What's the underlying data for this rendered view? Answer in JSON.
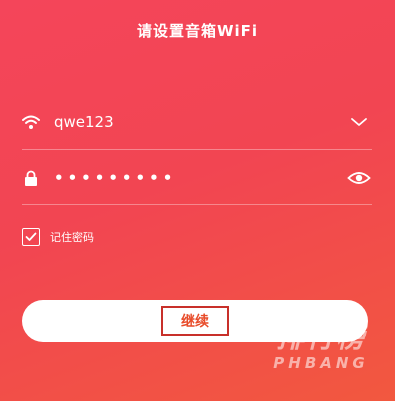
{
  "header": {
    "title": "请设置音箱WiFi"
  },
  "wifi": {
    "icon": "wifi-icon",
    "ssid": "qwe123",
    "dropdown_icon": "chevron-down-icon"
  },
  "password": {
    "icon": "lock-icon",
    "masked_value": "•••••••••",
    "visibility_icon": "eye-icon"
  },
  "remember": {
    "checked": true,
    "label": "记住密码"
  },
  "actions": {
    "continue_label": "继续"
  },
  "watermark": {
    "top": "排行榜",
    "bottom": "PHBANG"
  },
  "colors": {
    "background_start": "#f4455a",
    "background_end": "#f2583f",
    "button_text": "#e84c2a",
    "highlight_border": "#c8302a"
  }
}
